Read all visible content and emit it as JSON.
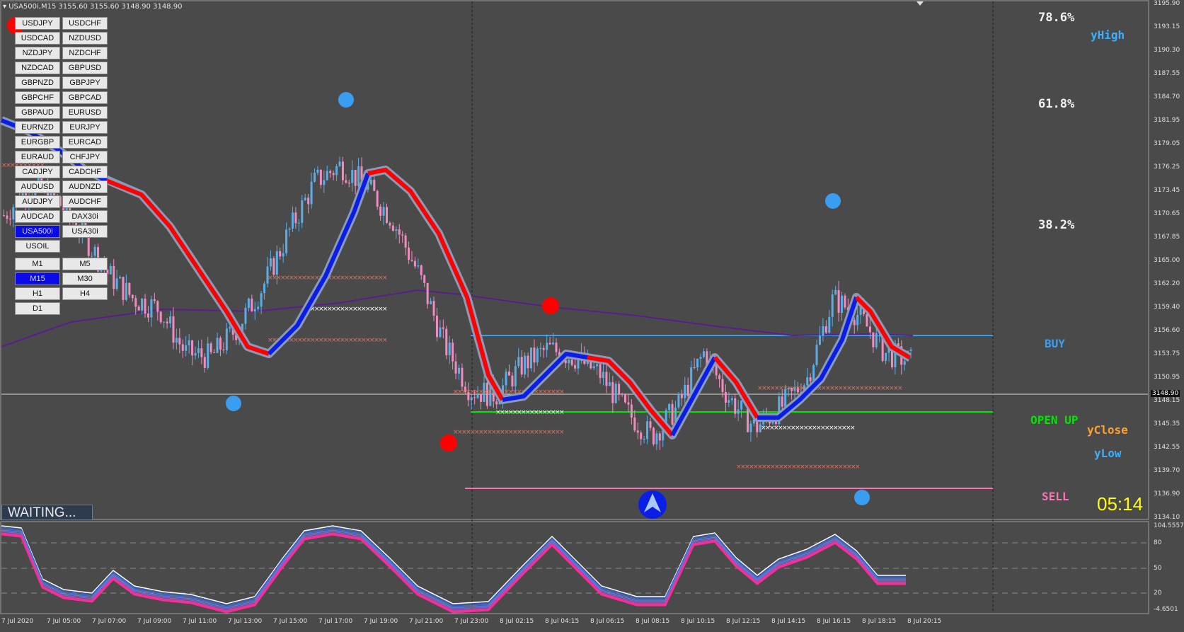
{
  "chart": {
    "symbol": "USA500i,M15",
    "ohlc": "3155.60 3155.60 3148.90 3148.90",
    "current_price": "3148.90",
    "status": "WAITING...",
    "countdown": "05:14"
  },
  "pairs": [
    "USDJPY",
    "USDCHF",
    "USDCAD",
    "NZDUSD",
    "NZDJPY",
    "NZDCHF",
    "NZDCAD",
    "GBPUSD",
    "GBPNZD",
    "GBPJPY",
    "GBPCHF",
    "GBPCAD",
    "GBPAUD",
    "EURUSD",
    "EURNZD",
    "EURJPY",
    "EURGBP",
    "EURCAD",
    "EURAUD",
    "CHFJPY",
    "CADJPY",
    "CADCHF",
    "AUDUSD",
    "AUDNZD",
    "AUDJPY",
    "AUDCHF",
    "AUDCAD",
    "DAX30i",
    "USA500i",
    "USA30i",
    "USOIL"
  ],
  "active_pair": "USA500i",
  "timeframes": [
    "M1",
    "M5",
    "M15",
    "M30",
    "H1",
    "H4",
    "D1"
  ],
  "active_timeframe": "M15",
  "levels": {
    "fib_786": "78.6%",
    "fib_618": "61.8%",
    "fib_382": "38.2%",
    "yhigh": "yHigh",
    "buy": "BUY",
    "open_up": "OPEN UP",
    "yclose": "yClose",
    "ylow": "yLow",
    "sell": "SELL"
  },
  "colors": {
    "background": "#4a4a4a",
    "bull_candle": "#5aaee6",
    "bear_candle": "#f08cc0",
    "ma_up": "#0a1ee6",
    "ma_down": "#ff0000",
    "buy_line": "#3a9ef0",
    "open_line": "#00e600",
    "sell_line": "#ff70b8",
    "slow_ma": "#5a1e8c",
    "countdown": "#ffff00"
  },
  "price_axis": [
    "3195.90",
    "3193.15",
    "3190.30",
    "3187.55",
    "3184.70",
    "3181.95",
    "3179.05",
    "3176.25",
    "3173.45",
    "3170.65",
    "3167.85",
    "3165.00",
    "3162.20",
    "3159.40",
    "3156.60",
    "3153.75",
    "3150.95",
    "3148.15",
    "3145.35",
    "3142.55",
    "3139.70",
    "3136.90",
    "3134.10"
  ],
  "osc_axis": [
    "104.5557",
    "80",
    "50",
    "20",
    "-4.6501"
  ],
  "time_axis": [
    "7 Jul 2020",
    "7 Jul 05:00",
    "7 Jul 07:00",
    "7 Jul 09:00",
    "7 Jul 11:00",
    "7 Jul 13:00",
    "7 Jul 15:00",
    "7 Jul 17:00",
    "7 Jul 19:00",
    "7 Jul 21:00",
    "7 Jul 23:00",
    "8 Jul 02:15",
    "8 Jul 04:15",
    "8 Jul 06:15",
    "8 Jul 08:15",
    "8 Jul 10:15",
    "8 Jul 12:15",
    "8 Jul 14:15",
    "8 Jul 16:15",
    "8 Jul 18:15",
    "8 Jul 20:15"
  ],
  "chart_data": {
    "type": "line",
    "title": "USA500i,M15",
    "y_range": [
      3134.1,
      3195.9
    ],
    "price_curve": [
      3170.5,
      3174.0,
      3172.5,
      3168.5,
      3163.5,
      3160.5,
      3159.3,
      3154.0,
      3153.5,
      3157.0,
      3162.0,
      3168.5,
      3174.5,
      3176.5,
      3174.0,
      3170.0,
      3163.5,
      3155.0,
      3149.5,
      3149.0,
      3152.5,
      3154.5,
      3153.5,
      3151.5,
      3147.0,
      3144.0,
      3147.5,
      3154.0,
      3148.5,
      3145.0,
      3147.5,
      3151.0,
      3160.5,
      3158.5,
      3154.0,
      3153.0
    ],
    "horizontal_levels": {
      "buy": 3156.0,
      "open_up": 3147.1,
      "sell": 3137.6,
      "current": 3148.9
    }
  }
}
